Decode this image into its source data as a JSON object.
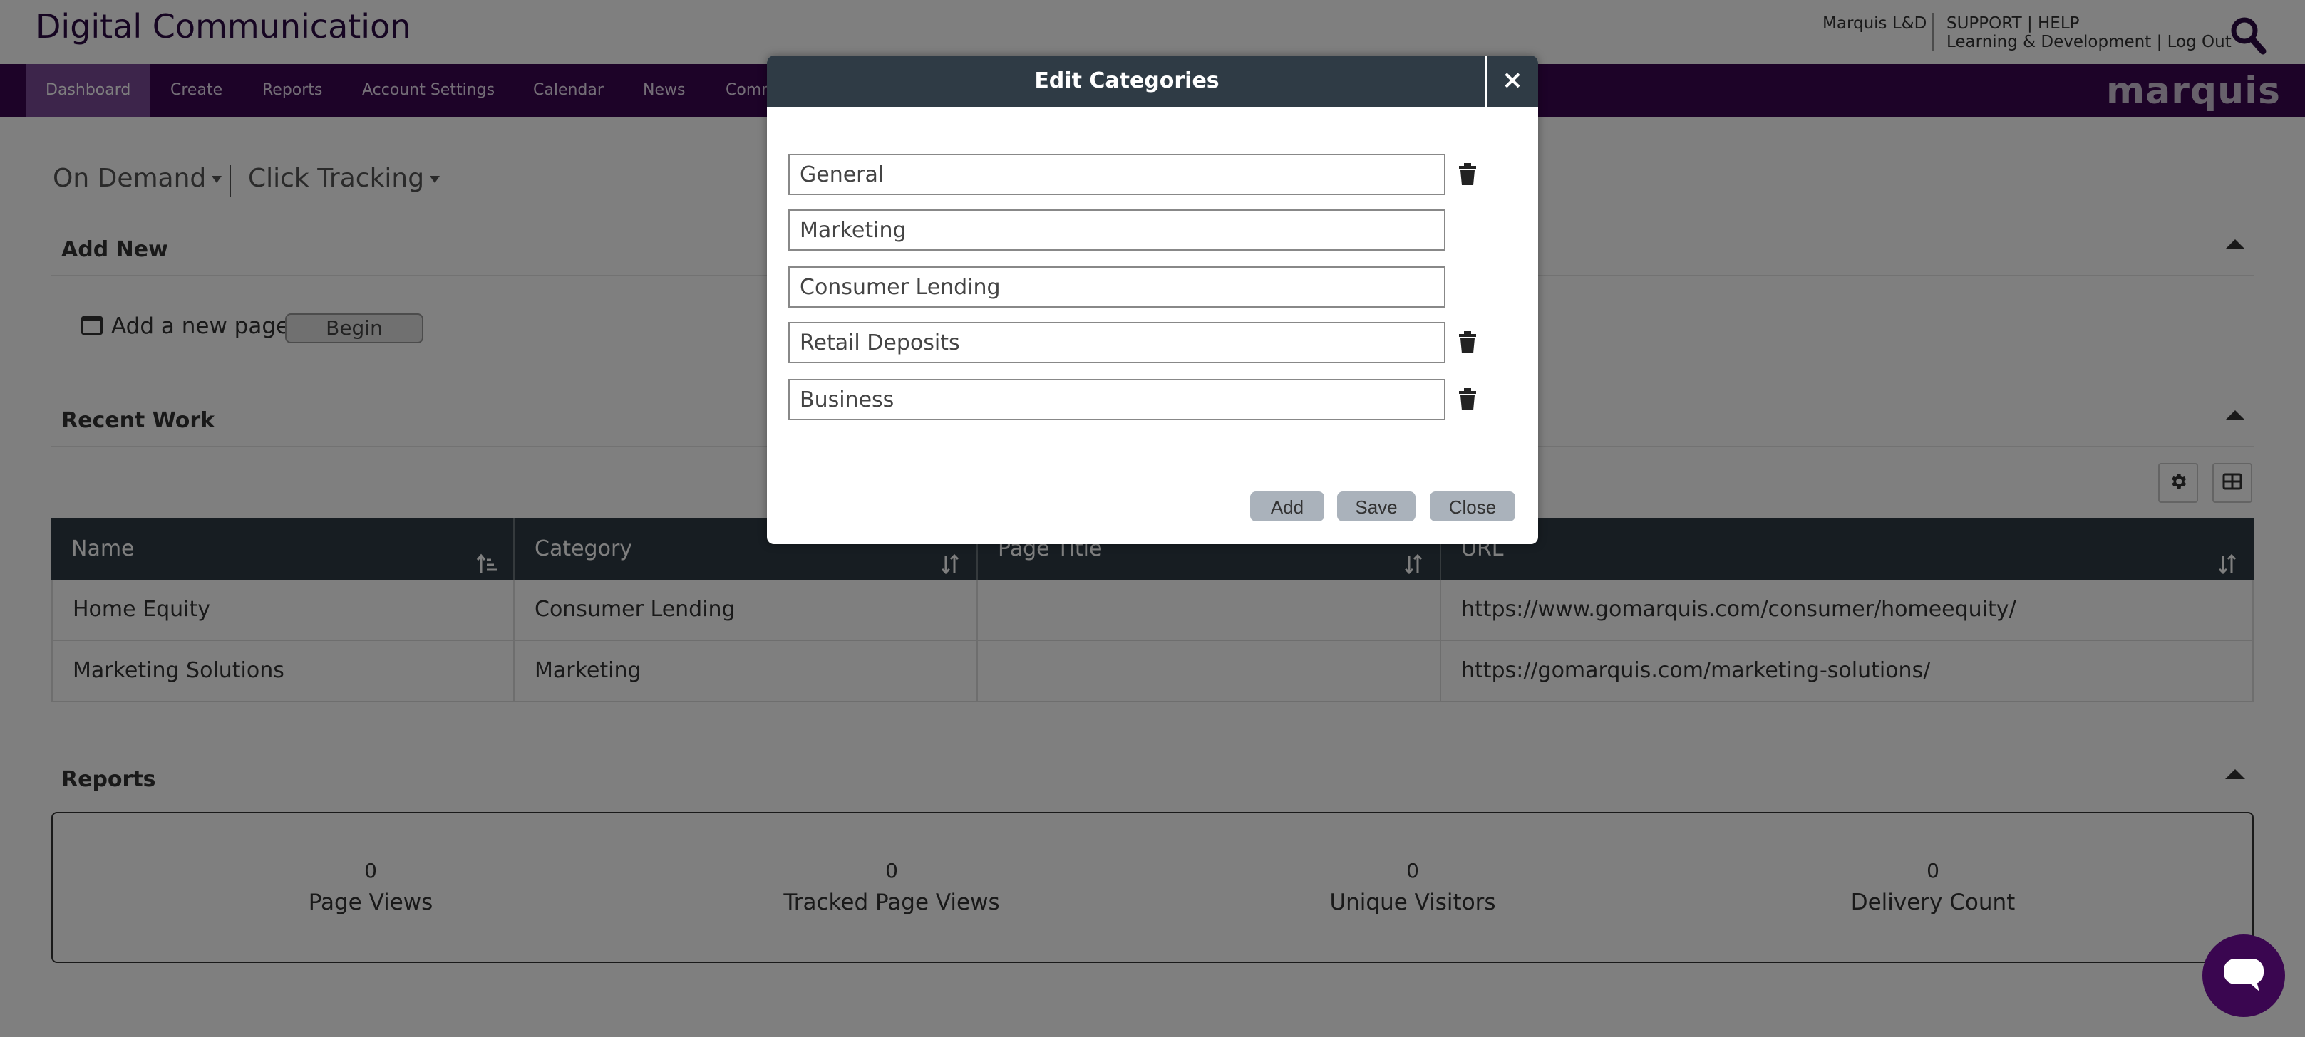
{
  "header": {
    "app_title": "Digital Communication",
    "org_name": "Marquis L&D",
    "support": "SUPPORT",
    "help": "HELP",
    "learning": "Learning & Development",
    "logout": "Log Out",
    "pipe": "|",
    "search_icon": "search-icon"
  },
  "nav": {
    "items": [
      "Dashboard",
      "Create",
      "Reports",
      "Account Settings",
      "Calendar",
      "News",
      "Comm"
    ],
    "active": "Dashboard",
    "brand": "marquis"
  },
  "dropdowns": {
    "on_demand": "On Demand",
    "click_tracking": "Click Tracking"
  },
  "add_new": {
    "title": "Add New",
    "add_page_label": "Add a new page",
    "begin_label": "Begin"
  },
  "recent_work": {
    "title": "Recent Work",
    "columns": [
      "Name",
      "Category",
      "Page Title",
      "URL"
    ],
    "rows": [
      [
        "Home Equity",
        "Consumer Lending",
        "",
        "https://www.gomarquis.com/consumer/homeequity/"
      ],
      [
        "Marketing Solutions",
        "Marketing",
        "",
        "https://gomarquis.com/marketing-solutions/"
      ]
    ]
  },
  "reports": {
    "title": "Reports",
    "stats": [
      {
        "value": "0",
        "label": "Page Views"
      },
      {
        "value": "0",
        "label": "Tracked Page Views"
      },
      {
        "value": "0",
        "label": "Unique Visitors"
      },
      {
        "value": "0",
        "label": "Delivery Count"
      }
    ]
  },
  "modal": {
    "title": "Edit Categories",
    "close_x": "×",
    "categories": [
      {
        "value": "General",
        "deletable": true
      },
      {
        "value": "Marketing",
        "deletable": false
      },
      {
        "value": "Consumer Lending",
        "deletable": false
      },
      {
        "value": "Retail Deposits",
        "deletable": true
      },
      {
        "value": "Business",
        "deletable": true
      }
    ],
    "add_label": "Add",
    "save_label": "Save",
    "close_label": "Close"
  },
  "colors": {
    "nav_bg": "#3a0650",
    "nav_active": "#7b4b97",
    "table_header": "#2f3b45",
    "modal_button": "#aab2bb"
  }
}
